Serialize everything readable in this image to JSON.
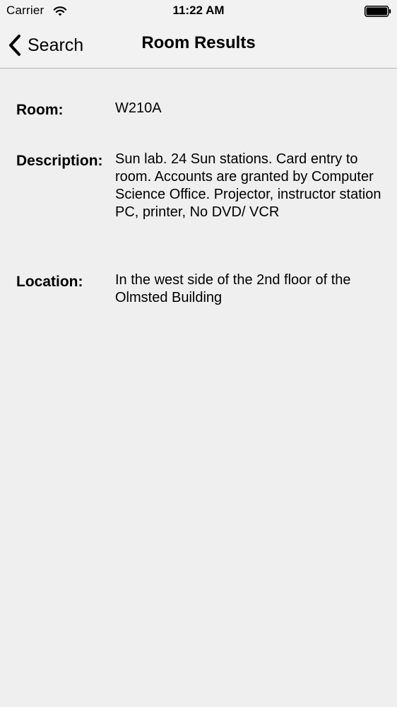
{
  "status_bar": {
    "carrier": "Carrier",
    "time": "11:22 AM",
    "wifi_icon": "wifi-icon",
    "battery_icon": "battery-icon"
  },
  "nav": {
    "back_label": "Search",
    "back_icon": "chevron-left-icon",
    "title": "Room Results"
  },
  "details": {
    "room": {
      "label": "Room:",
      "value": "W210A"
    },
    "description": {
      "label": "Description:",
      "value": "Sun lab. 24 Sun stations. Card entry to room. Accounts are granted by Computer Science Office. Projector, instructor station PC, printer, No DVD/ VCR"
    },
    "location": {
      "label": "Location:",
      "value": "In the west side of the 2nd floor of the Olmsted Building"
    }
  },
  "colors": {
    "background": "#efefef",
    "bar_background": "#f2f2f2",
    "separator": "#b2b2b2",
    "text": "#000000"
  }
}
